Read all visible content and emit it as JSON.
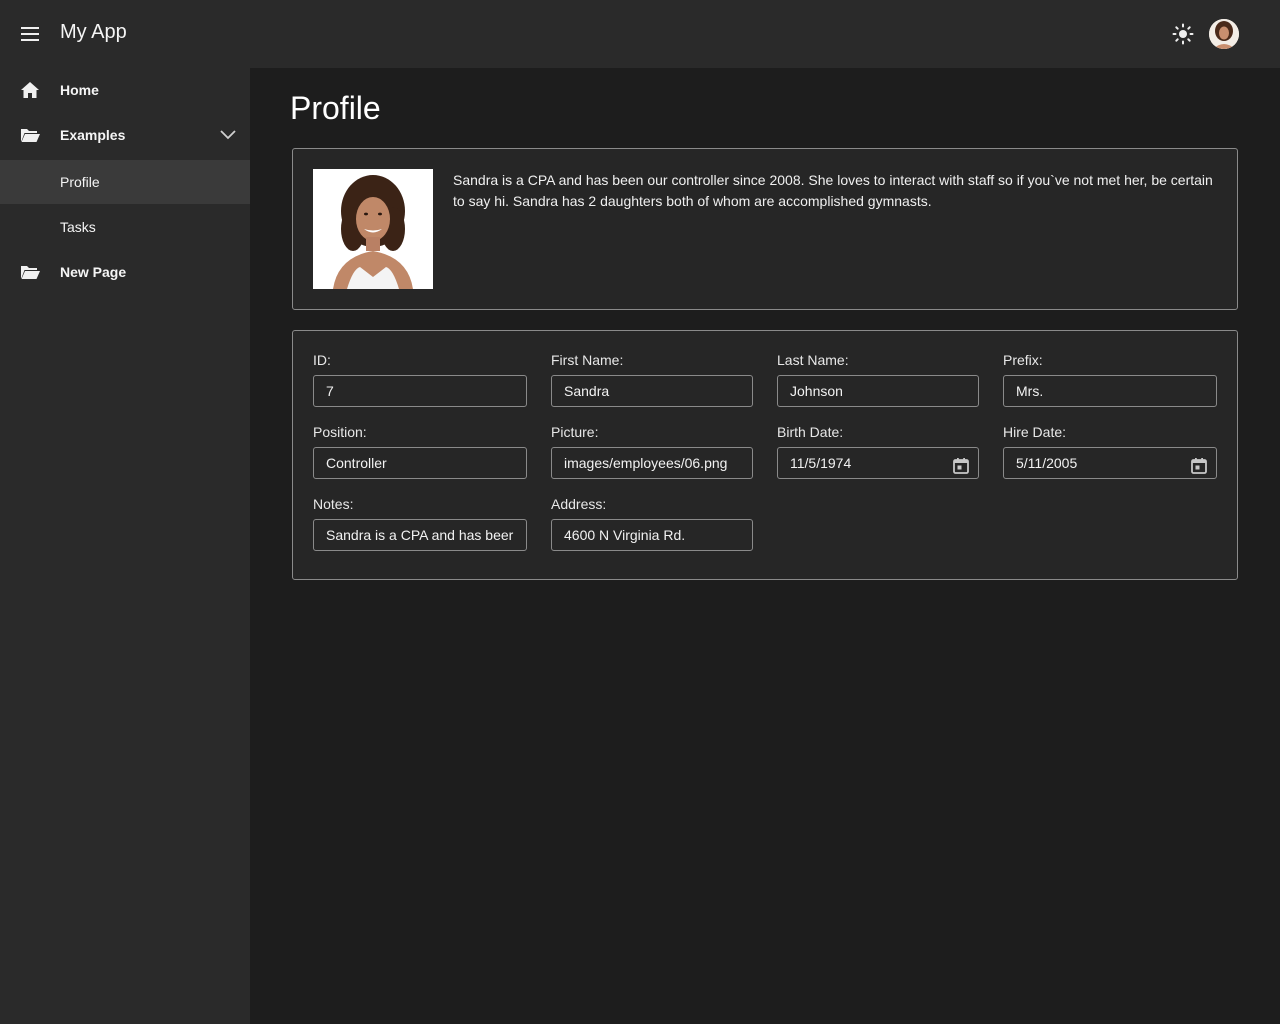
{
  "app": {
    "title": "My App",
    "menu_icon": "hamburger-menu-icon",
    "theme_icon": "sun-icon",
    "avatar_icon": "user-avatar"
  },
  "sidebar": {
    "items": [
      {
        "label": "Home",
        "icon": "home-icon"
      },
      {
        "label": "Examples",
        "icon": "folder-open-icon",
        "expanded": true
      },
      {
        "label": "Profile",
        "selected": true
      },
      {
        "label": "Tasks"
      },
      {
        "label": "New Page",
        "icon": "folder-open-icon"
      }
    ]
  },
  "page": {
    "title": "Profile",
    "bio": "Sandra is a CPA and has been our controller since 2008. She loves to interact with staff so if you`ve not met her, be certain to say hi. Sandra has 2 daughters both of whom are accomplished gymnasts."
  },
  "form": {
    "id": {
      "label": "ID:",
      "value": "7"
    },
    "first_name": {
      "label": "First Name:",
      "value": "Sandra"
    },
    "last_name": {
      "label": "Last Name:",
      "value": "Johnson"
    },
    "prefix": {
      "label": "Prefix:",
      "value": "Mrs."
    },
    "position": {
      "label": "Position:",
      "value": "Controller"
    },
    "picture": {
      "label": "Picture:",
      "value": "images/employees/06.png"
    },
    "birth_date": {
      "label": "Birth Date:",
      "value": "11/5/1974"
    },
    "hire_date": {
      "label": "Hire Date:",
      "value": "5/11/2005"
    },
    "notes": {
      "label": "Notes:",
      "value": "Sandra is a CPA and has beer"
    },
    "address": {
      "label": "Address:",
      "value": "4600 N Virginia Rd."
    }
  },
  "colors": {
    "background": "#1d1d1d",
    "panel": "#2a2a2a",
    "selected": "#3a3a3a",
    "border": "#8a8a8a"
  }
}
